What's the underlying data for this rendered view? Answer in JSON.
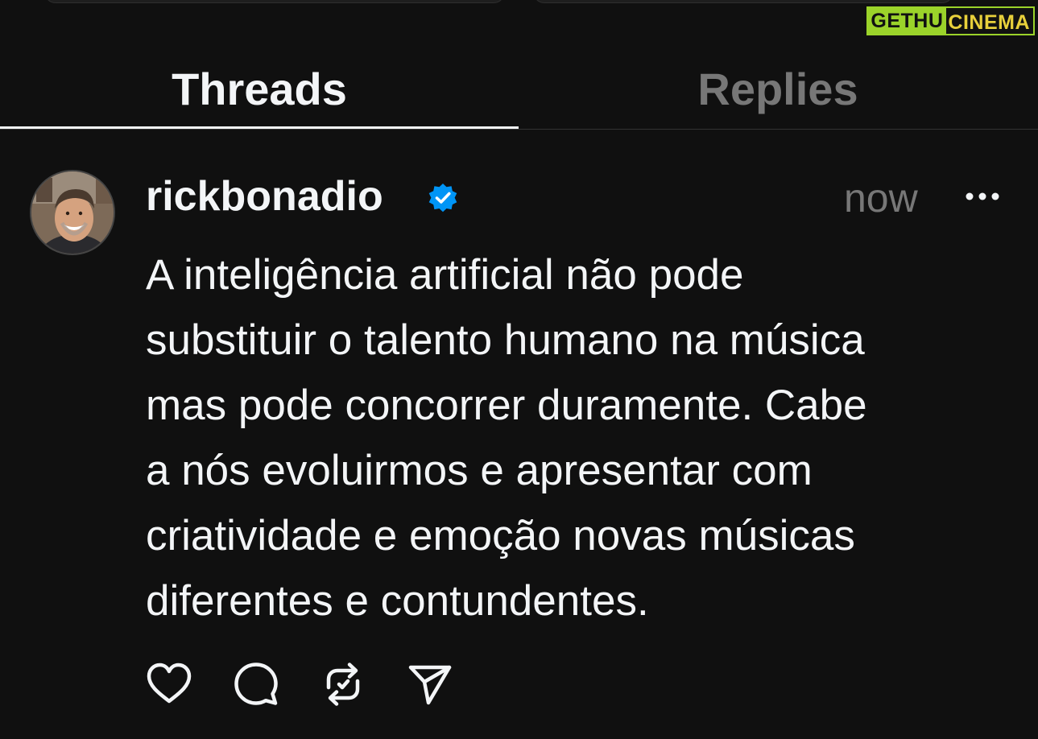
{
  "watermark": {
    "part1": "GETHU",
    "part2": "CINEMA"
  },
  "tabs": [
    {
      "label": "Threads",
      "active": true
    },
    {
      "label": "Replies",
      "active": false
    }
  ],
  "post": {
    "username": "rickbonadio",
    "verified": true,
    "timestamp": "now",
    "text": "A inteligência artificial não pode\nsubstituir o talento humano na música\nmas pode concorrer duramente. Cabe\na nós evoluirmos e apresentar com\ncriatividade e emoção novas músicas\ndiferentes e contundentes."
  },
  "icons": {
    "verified": "verified-badge-icon",
    "more": "more-options-icon",
    "like": "heart-icon",
    "reply": "comment-icon",
    "repost": "repost-icon",
    "share": "send-icon"
  },
  "colors": {
    "background": "#101010",
    "text": "#f3f5f7",
    "muted": "#777777",
    "verified": "#0095f6"
  }
}
